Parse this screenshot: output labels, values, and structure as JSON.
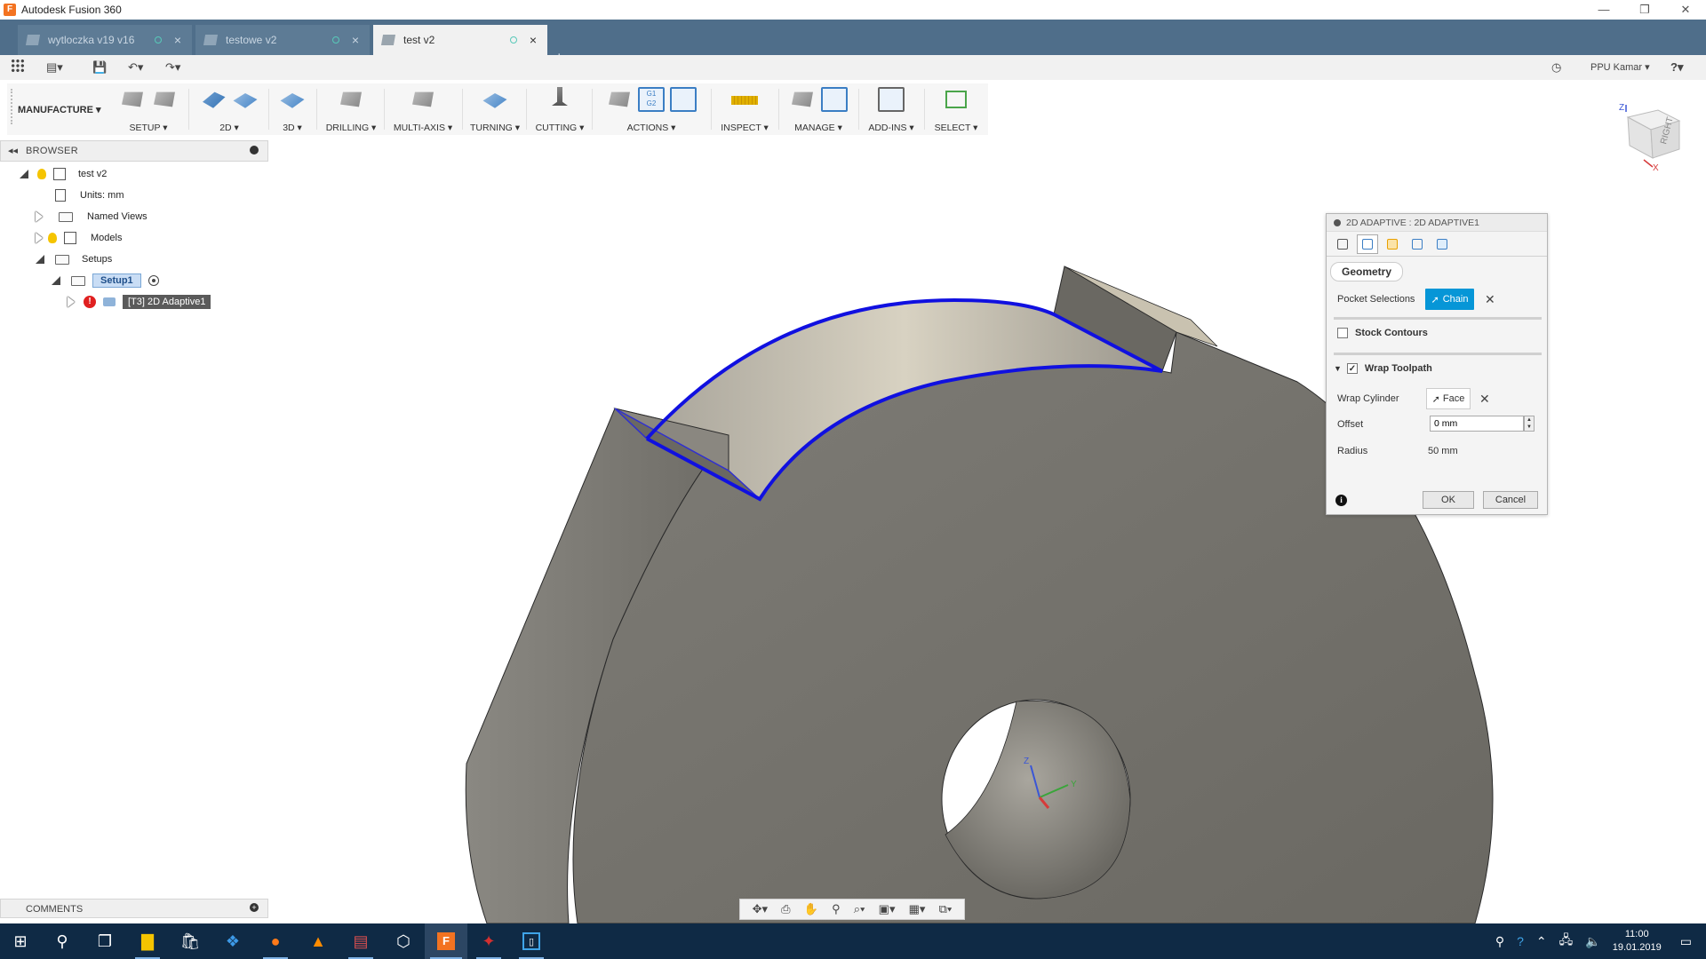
{
  "window": {
    "title": "Autodesk Fusion 360",
    "controls": [
      "—",
      "❐",
      "✕"
    ]
  },
  "tabs": [
    {
      "label": "wytloczka v19 v16"
    },
    {
      "label": "testowe v2"
    },
    {
      "label": "test v2"
    }
  ],
  "quick_access": {
    "user": "PPU Kamar ▾",
    "help": "?▾"
  },
  "toolbar": {
    "workspace": "MANUFACTURE ▾",
    "groups": [
      "SETUP ▾",
      "2D ▾",
      "3D ▾",
      "DRILLING ▾",
      "MULTI-AXIS ▾",
      "TURNING ▾",
      "CUTTING ▾",
      "ACTIONS ▾",
      "INSPECT ▾",
      "MANAGE ▾",
      "ADD-INS ▾",
      "SELECT ▾"
    ],
    "g1g2_label": "G1\nG2"
  },
  "browser": {
    "title": "BROWSER",
    "collapse": "◂◂",
    "items": {
      "root": "test v2",
      "units": "Units: mm",
      "named_views": "Named Views",
      "models": "Models",
      "setups": "Setups",
      "setup1": "Setup1",
      "operation": "[T3] 2D Adaptive1"
    }
  },
  "dialog": {
    "title": "2D ADAPTIVE : 2D ADAPTIVE1",
    "active_tab": "Geometry",
    "pocket_selections_label": "Pocket Selections",
    "chain_label": "Chain",
    "stock_contours_label": "Stock Contours",
    "wrap_toolpath_label": "Wrap Toolpath",
    "wrap_cylinder_label": "Wrap Cylinder",
    "face_label": "Face",
    "offset_label": "Offset",
    "offset_value": "0 mm",
    "radius_label": "Radius",
    "radius_value": "50 mm",
    "ok_label": "OK",
    "cancel_label": "Cancel",
    "stock_contours_checked": false,
    "wrap_toolpath_checked": true
  },
  "comments": {
    "title": "COMMENTS"
  },
  "viewcube": {
    "face_label": "RIGHT",
    "axis_z": "Z",
    "axis_x": "X"
  },
  "triad": {
    "z": "Z",
    "y": "Y"
  },
  "taskbar": {
    "time": "11:00",
    "date": "19.01.2019",
    "apps": [
      "windows-start",
      "search",
      "task-view",
      "file-explorer",
      "store",
      "dropbox",
      "firefox",
      "vlc",
      "calculator-app",
      "virtualbox",
      "fusion-360",
      "app-red",
      "app-blue"
    ]
  },
  "colors": {
    "accent": "#0696d7",
    "tabbar": "#4f6e8a",
    "taskbar": "#0f2a45",
    "model_gray": "#72706a",
    "selection_blue": "#1010e0"
  }
}
